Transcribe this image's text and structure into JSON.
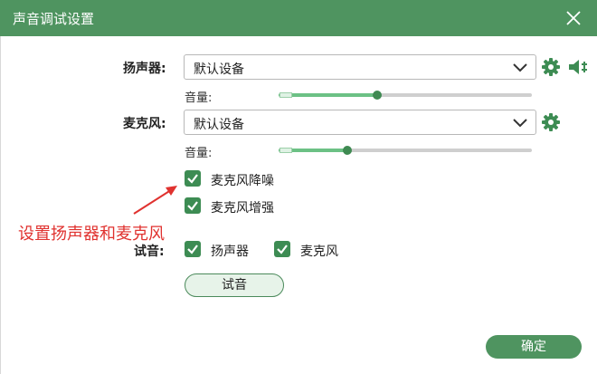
{
  "window": {
    "title": "声音调试设置"
  },
  "speaker": {
    "label": "扬声器:",
    "device": "默认设备",
    "volume_label": "音量:",
    "volume": 0.39,
    "icons": [
      "gear-icon",
      "speaker-volume-icon"
    ]
  },
  "mic": {
    "label": "麦克风:",
    "device": "默认设备",
    "volume_label": "音量:",
    "volume": 0.27,
    "icons": [
      "gear-icon"
    ]
  },
  "options": [
    {
      "label": "麦克风降噪",
      "checked": true
    },
    {
      "label": "麦克风增强",
      "checked": true
    }
  ],
  "annotation": "设置扬声器和麦克风",
  "test": {
    "label": "试音:",
    "speaker_label": "扬声器",
    "speaker_checked": true,
    "mic_label": "麦克风",
    "mic_checked": true,
    "button": "试音"
  },
  "footer": {
    "confirm": "确定"
  },
  "colors": {
    "titlebar": "#4f9460",
    "accent": "#3d8c53",
    "slider_fill": "#6cc185",
    "annotation": "#e0322f"
  }
}
